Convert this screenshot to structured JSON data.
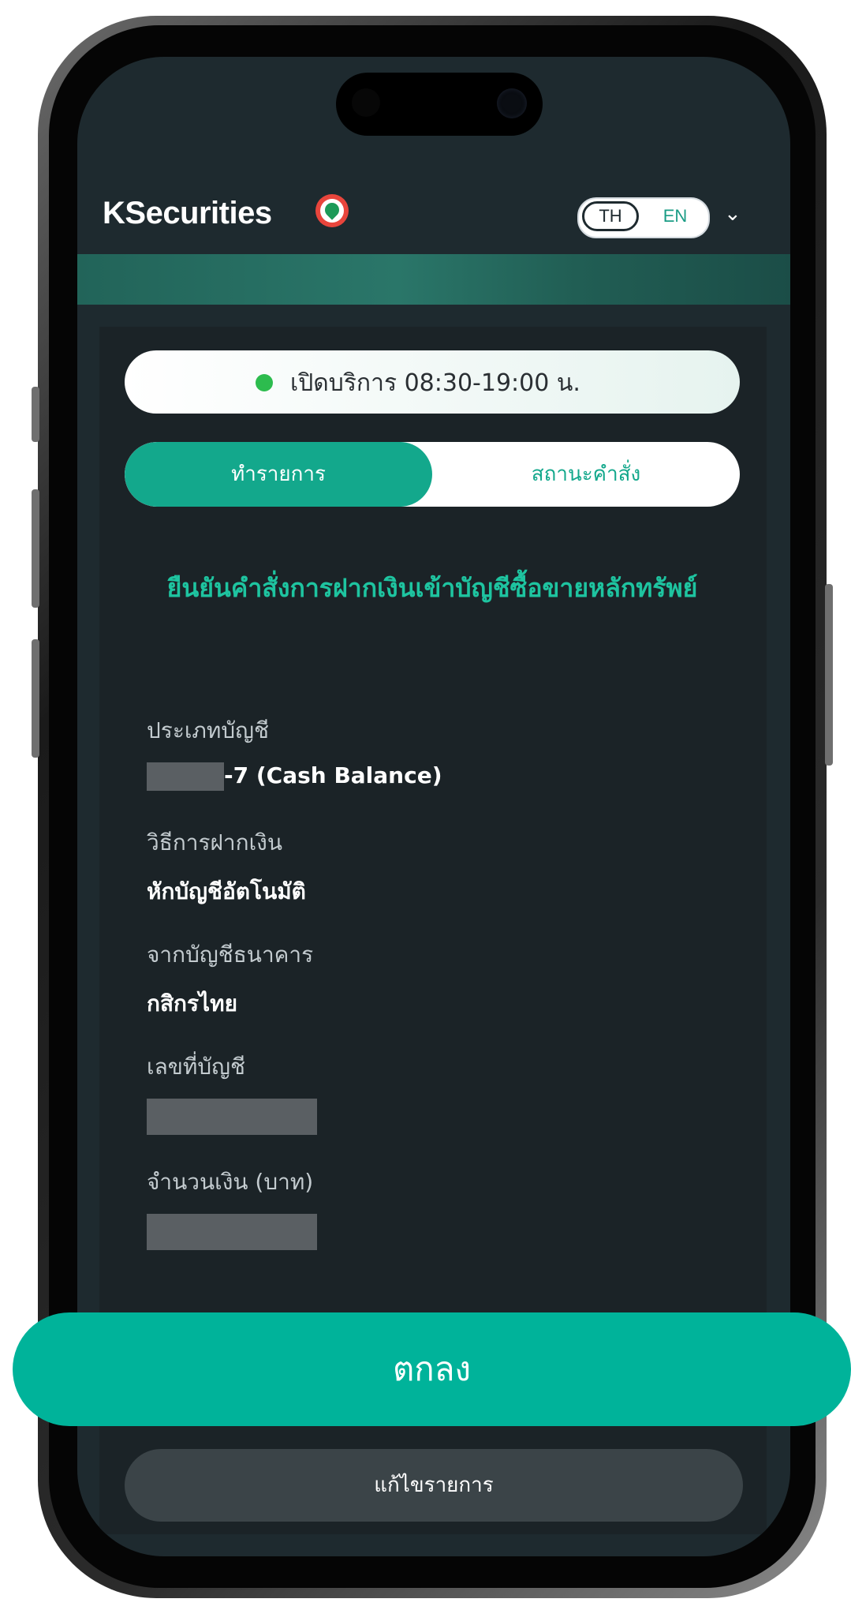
{
  "header": {
    "logo_text": "KSecurities",
    "lang_th": "TH",
    "lang_en": "EN",
    "chevron_glyph": "⌄"
  },
  "service_hours": {
    "text": "เปิดบริการ 08:30-19:00 น.",
    "status_color": "#2dbc4e"
  },
  "tabs": [
    {
      "label": "ทำรายการ",
      "active": true
    },
    {
      "label": "สถานะคำสั่ง",
      "active": false
    }
  ],
  "page_title": "ยืนยันคำสั่งการฝากเงินเข้าบัญชีซื้อขายหลักทรัพย์",
  "fields": {
    "account_type": {
      "label": "ประเภทบัญชี",
      "value": "-7 (Cash Balance)"
    },
    "deposit_method": {
      "label": "วิธีการฝากเงิน",
      "value": "หักบัญชีอัตโนมัติ"
    },
    "from_bank": {
      "label": "จากบัญชีธนาคาร",
      "value": "กสิกรไทย"
    },
    "account_number": {
      "label": "เลขที่บัญชี"
    },
    "amount": {
      "label": "จำนวนเงิน (บาท)"
    }
  },
  "buttons": {
    "confirm": "ตกลง",
    "edit": "แก้ไขรายการ"
  },
  "colors": {
    "accent": "#13a88c",
    "title": "#1ec4a0",
    "confirm_button": "#00b39a",
    "panel": "#1b2327"
  }
}
